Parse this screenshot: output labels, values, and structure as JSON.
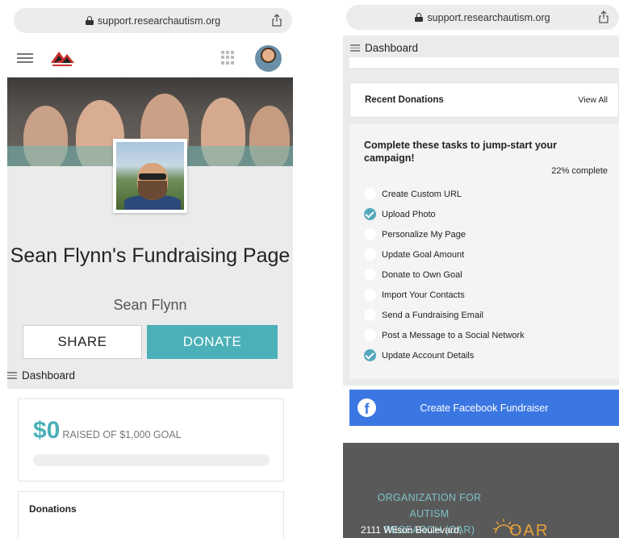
{
  "left": {
    "browser": {
      "url": "support.researchautism.org"
    },
    "header": {
      "logo_icon": "race-logo-icon",
      "menu_icon": "hamburger-icon",
      "apps_icon": "grid-icon"
    },
    "page": {
      "title": "Sean Flynn's Fundraising Page",
      "subtitle": "Sean Flynn",
      "share_label": "SHARE",
      "donate_label": "DONATE",
      "dashboard_label": "Dashboard"
    },
    "goal": {
      "raised": "$0",
      "raised_text": "RAISED OF $1,000 GOAL",
      "progress_fraction": 0
    },
    "donations": {
      "title": "Donations"
    }
  },
  "right": {
    "browser": {
      "url": "support.researchautism.org"
    },
    "dashboard_label": "Dashboard",
    "recent": {
      "title": "Recent Donations",
      "view_all": "View All"
    },
    "tasks": {
      "heading": "Complete these tasks to jump-start your campaign!",
      "percent": "22% complete",
      "items": [
        {
          "label": "Create Custom URL",
          "done": false
        },
        {
          "label": "Upload Photo",
          "done": true
        },
        {
          "label": "Personalize My Page",
          "done": false
        },
        {
          "label": "Update Goal Amount",
          "done": false
        },
        {
          "label": "Donate to Own Goal",
          "done": false
        },
        {
          "label": "Import Your Contacts",
          "done": false
        },
        {
          "label": "Send a Fundraising Email",
          "done": false
        },
        {
          "label": "Post a Message to a Social Network",
          "done": false
        },
        {
          "label": "Update Account Details",
          "done": true
        }
      ]
    },
    "facebook": {
      "label": "Create Facebook Fundraiser"
    },
    "footer": {
      "org_line1": "ORGANIZATION FOR AUTISM",
      "org_line2": "RESEARCH (OAR)",
      "address": "2111 Wilson Boulevard,",
      "logo_text": "OAR"
    }
  },
  "colors": {
    "accent": "#4bb0b8",
    "facebook": "#3b77e3",
    "check": "#54a8bd",
    "footer": "#595959"
  }
}
